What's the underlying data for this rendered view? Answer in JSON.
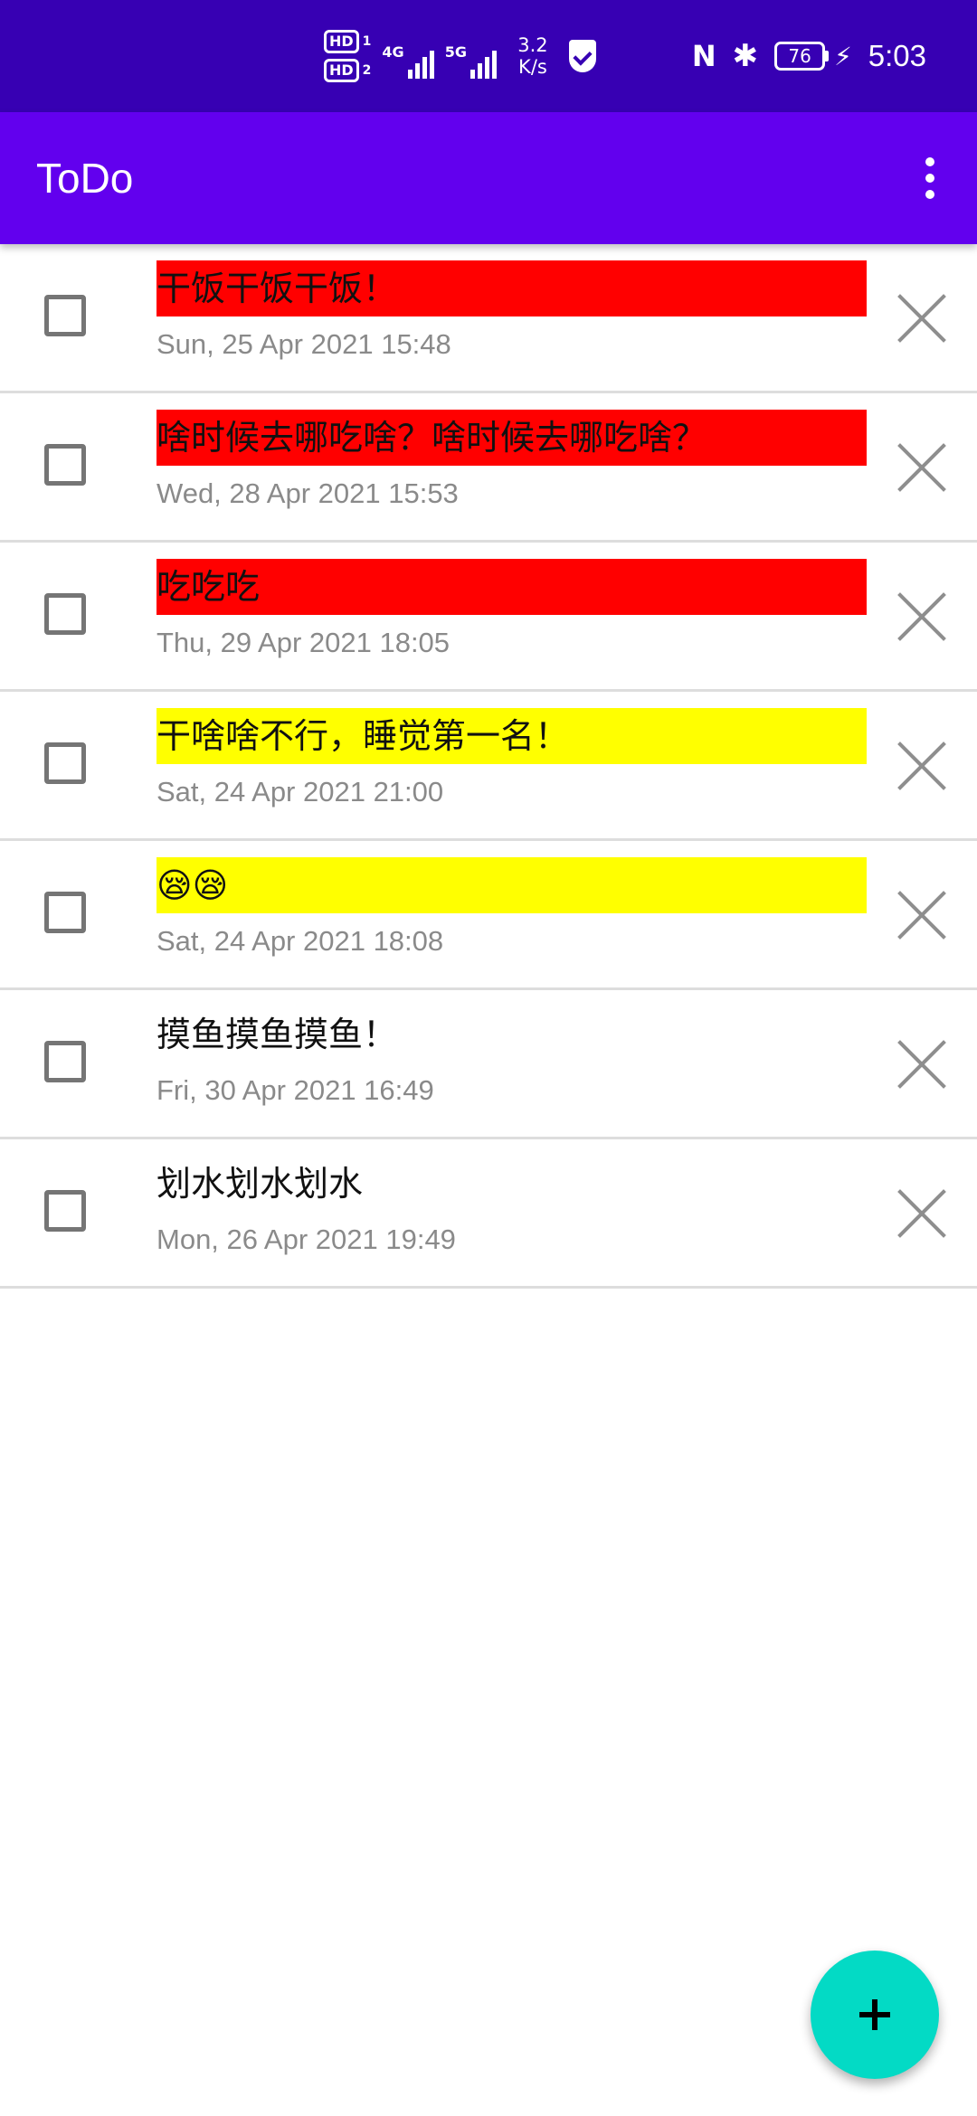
{
  "status_bar": {
    "hd1": "HD",
    "hd1_sub": "1",
    "hd2": "HD",
    "hd2_sub": "2",
    "net1": "4G",
    "net2": "5G",
    "speed_value": "3.2",
    "speed_unit": "K/s",
    "nfc": "N",
    "bluetooth": "✱",
    "battery": "76",
    "charging": "⚡",
    "time": "5:03",
    "icons": [
      "hd-icon",
      "signal-icon",
      "shield-check-icon",
      "nfc-icon",
      "bluetooth-icon",
      "battery-icon",
      "charging-icon"
    ]
  },
  "app_bar": {
    "title": "ToDo",
    "menu_icon": "more-vert-icon"
  },
  "colors": {
    "status_bar": "#3700b3",
    "app_bar": "#6200ee",
    "fab": "#03dac5",
    "priority_high": "#ff0000",
    "priority_medium": "#ffff00",
    "priority_none": "#ffffff"
  },
  "todos": [
    {
      "text": "干饭干饭干饭！",
      "date": "Sun, 25 Apr 2021 15:48",
      "highlight": "#ff0000",
      "checked": false
    },
    {
      "text": "啥时候去哪吃啥？啥时候去哪吃啥？",
      "date": "Wed, 28 Apr 2021 15:53",
      "highlight": "#ff0000",
      "checked": false
    },
    {
      "text": "吃吃吃",
      "date": "Thu, 29 Apr 2021 18:05",
      "highlight": "#ff0000",
      "checked": false
    },
    {
      "text": "干啥啥不行，睡觉第一名！",
      "date": "Sat, 24 Apr 2021 21:00",
      "highlight": "#ffff00",
      "checked": false
    },
    {
      "text": "😪😪",
      "date": "Sat, 24 Apr 2021 18:08",
      "highlight": "#ffff00",
      "checked": false
    },
    {
      "text": "摸鱼摸鱼摸鱼！",
      "date": "Fri, 30 Apr 2021 16:49",
      "highlight": "#ffffff",
      "checked": false
    },
    {
      "text": "划水划水划水",
      "date": "Mon, 26 Apr 2021 19:49",
      "highlight": "#ffffff",
      "checked": false
    }
  ],
  "fab": {
    "icon": "plus-icon"
  }
}
